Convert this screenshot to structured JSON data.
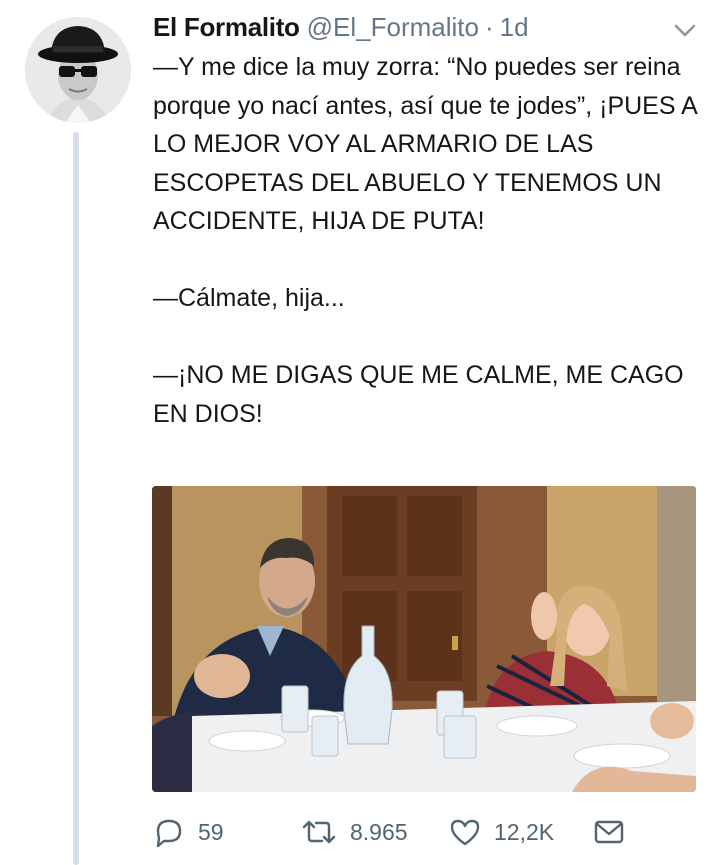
{
  "tweet": {
    "author_name": "El Formalito",
    "author_handle": "@El_Formalito",
    "separator": "·",
    "time": "1d",
    "paragraphs": [
      "—Y me dice la muy zorra: “No puedes ser reina porque yo nací antes, así que te jodes”, ¡PUES A LO MEJOR VOY AL ARMARIO DE LAS ESCOPETAS DEL ABUELO Y TENEMOS UN ACCIDENTE, HIJA DE PUTA!",
      "—Cálmate, hija...",
      "—¡NO ME DIGAS QUE ME CALME, ME CAGO EN DIOS!"
    ]
  },
  "actions": {
    "reply_count": "59",
    "retweet_count": "8.965",
    "like_count": "12,2K"
  },
  "icons": {
    "reply": "reply-icon",
    "retweet": "retweet-icon",
    "like": "heart-icon",
    "message": "envelope-icon",
    "menu": "chevron-down-icon"
  },
  "colors": {
    "text": "#14171a",
    "muted": "#657786",
    "thread_line": "#d6dde4"
  }
}
